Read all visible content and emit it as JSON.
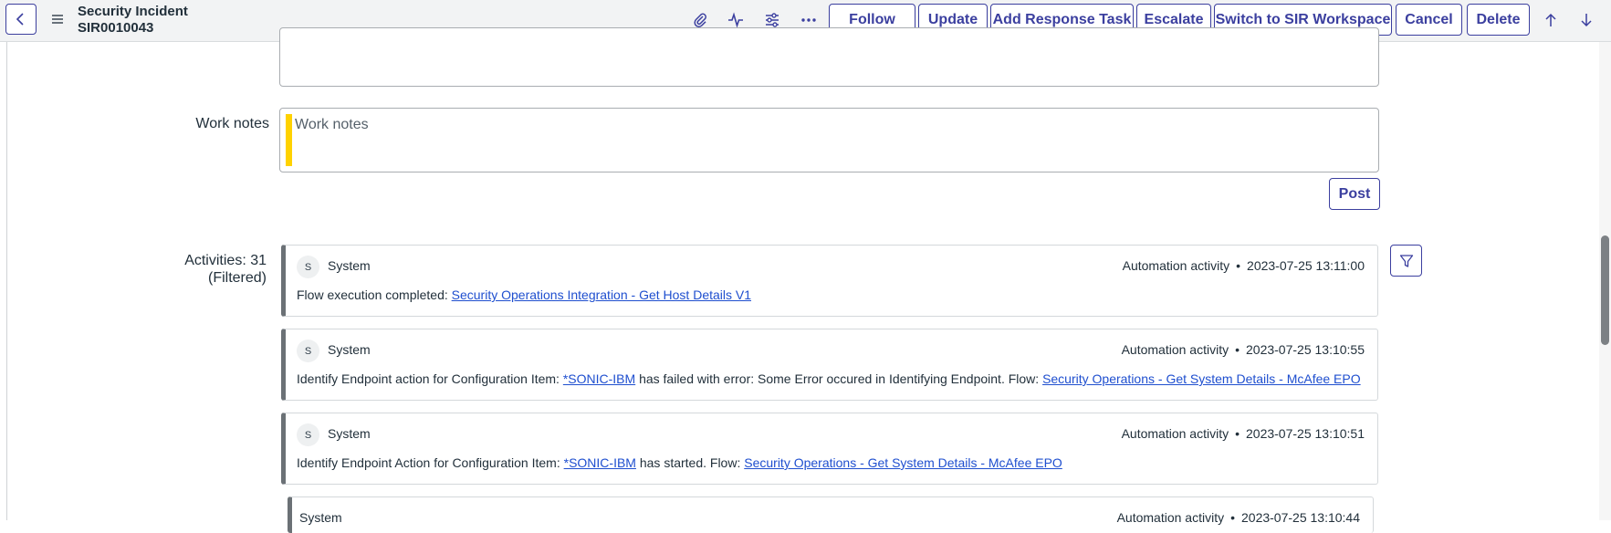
{
  "header": {
    "record_type": "Security Incident",
    "record_number": "SIR0010043",
    "icons": [
      "chevron-left-icon",
      "hamburger-menu-icon",
      "paperclip-icon",
      "activity-pulse-icon",
      "sliders-icon",
      "more-options-icon",
      "arrow-up-icon",
      "arrow-down-icon"
    ],
    "buttons": {
      "follow": "Follow",
      "update": "Update",
      "add_response_task": "Add Response Task",
      "escalate": "Escalate",
      "switch_workspace": "Switch to SIR Workspace",
      "cancel": "Cancel",
      "delete": "Delete"
    }
  },
  "form": {
    "work_notes_label": "Work notes",
    "work_notes_placeholder": "Work notes",
    "post_label": "Post",
    "activities_label": "Activities: 31",
    "activities_filter": "(Filtered)"
  },
  "activities": [
    {
      "avatar": "S",
      "author": "System",
      "type": "Automation activity",
      "bullet": "•",
      "time": "2023-07-25 13:11:00",
      "text1": "Flow execution completed: ",
      "link1": "Security Operations Integration - Get Host Details V1"
    },
    {
      "avatar": "S",
      "author": "System",
      "type": "Automation activity",
      "bullet": "•",
      "time": "2023-07-25 13:10:55",
      "text1": "Identify Endpoint action for Configuration Item: ",
      "link1": "*SONIC-IBM",
      "text2": " has failed with error: Some Error occured in Identifying Endpoint. Flow: ",
      "link2": "Security Operations - Get System Details - McAfee EPO"
    },
    {
      "avatar": "S",
      "author": "System",
      "type": "Automation activity",
      "bullet": "•",
      "time": "2023-07-25 13:10:51",
      "text1": "Identify Endpoint Action for Configuration Item: ",
      "link1": "*SONIC-IBM",
      "text2": " has started. Flow: ",
      "link2": "Security Operations - Get System Details - McAfee EPO"
    },
    {
      "author": "System",
      "type": "Automation activity",
      "bullet": "•",
      "time": "2023-07-25 13:10:44"
    }
  ],
  "colors": {
    "accent": "#3b3f9f",
    "link": "#1f4fcf",
    "mandatory": "#ffd200",
    "header_bg": "#f2f3f4"
  }
}
